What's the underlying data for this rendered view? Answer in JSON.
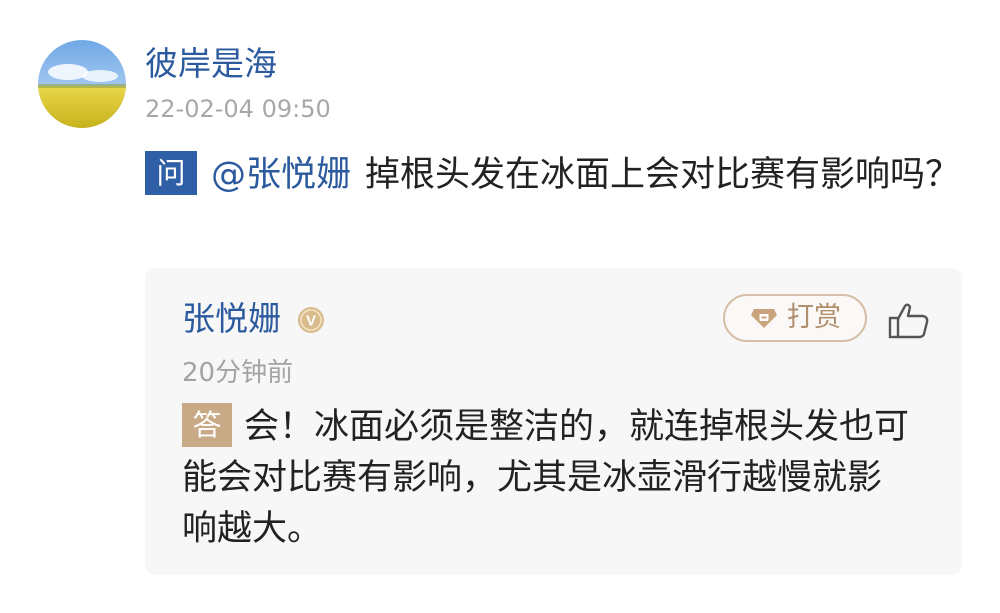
{
  "question": {
    "author_name": "彼岸是海",
    "timestamp": "22-02-04 09:50",
    "tag": "问",
    "mention": "@张悦姗",
    "text": "掉根头发在冰面上会对比赛有影响吗？"
  },
  "answer": {
    "author_name": "张悦姗",
    "verified_badge": "V",
    "tip_label": "打赏",
    "time_ago": "20分钟前",
    "tag": "答",
    "text": "会！冰面必须是整洁的，就连掉根头发也可能会对比赛有影响，尤其是冰壶滑行越慢就影响越大。"
  },
  "icons": {
    "avatar": "avatar-image",
    "verified": "verified-v-icon",
    "tip": "gift-coin-icon",
    "like": "thumbs-up-icon"
  },
  "colors": {
    "link_blue": "#2c5a9e",
    "question_tag_bg": "#2f5fa6",
    "answer_tag_bg": "#c9aa87",
    "tip_accent": "#b08f6d",
    "muted_text": "#a8a8a8",
    "card_bg": "#f7f7f7"
  }
}
